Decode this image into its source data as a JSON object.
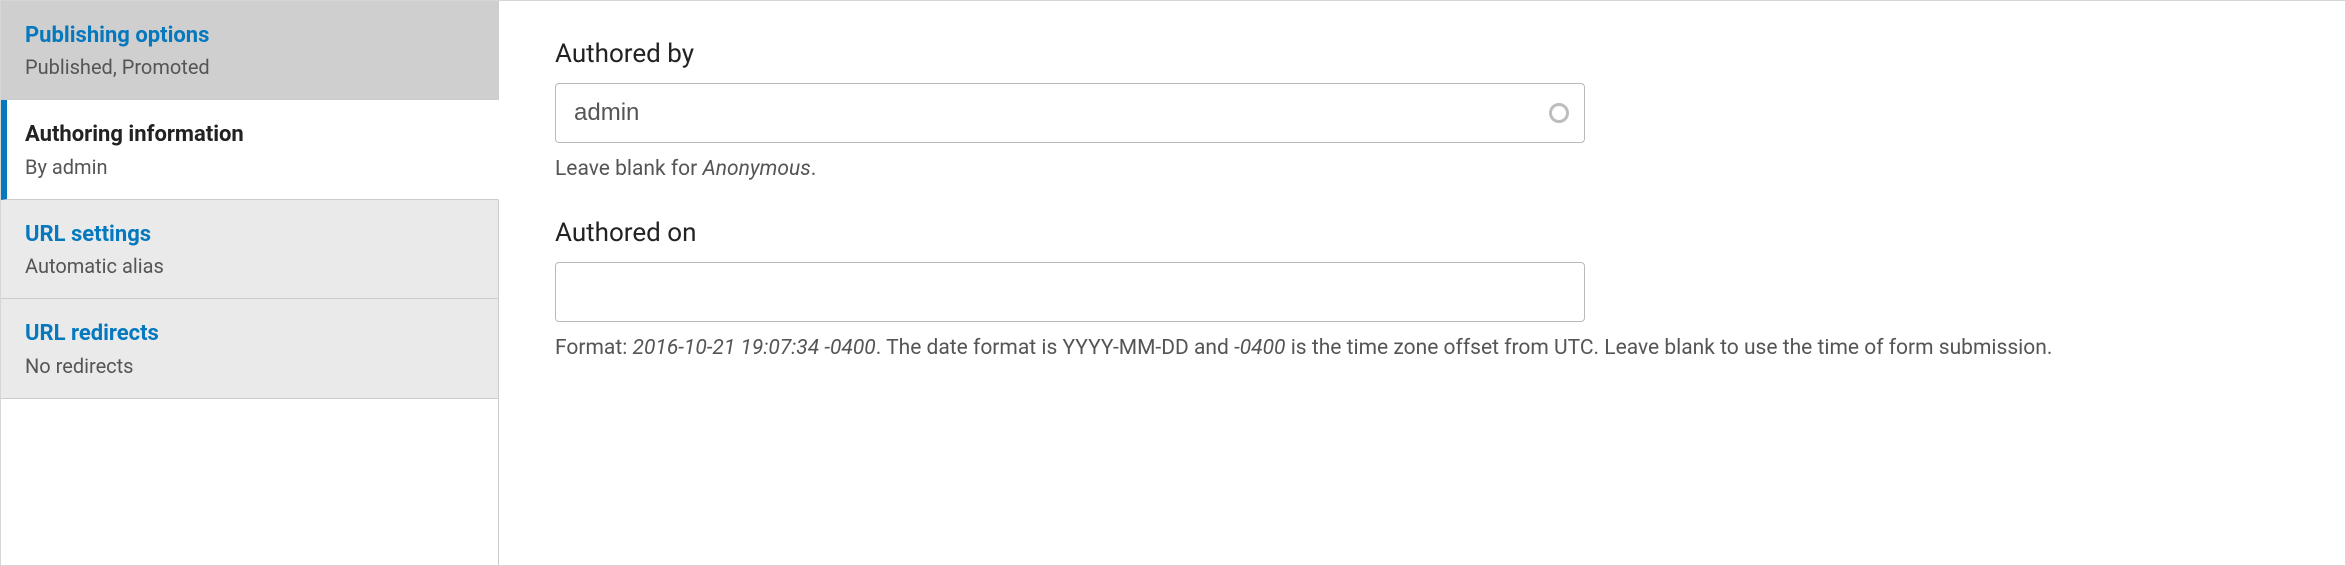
{
  "sidebar": {
    "tabs": [
      {
        "title": "Publishing options",
        "sub": "Published, Promoted"
      },
      {
        "title": "Authoring information",
        "sub": "By admin"
      },
      {
        "title": "URL settings",
        "sub": "Automatic alias"
      },
      {
        "title": "URL redirects",
        "sub": "No redirects"
      }
    ]
  },
  "panel": {
    "authored_by": {
      "label": "Authored by",
      "value": "admin",
      "help_prefix": "Leave blank for ",
      "help_em": "Anonymous",
      "help_suffix": "."
    },
    "authored_on": {
      "label": "Authored on",
      "value": "",
      "help_a": "Format: ",
      "help_b_em": "2016-10-21 19:07:34 -0400",
      "help_c": ". The date format is YYYY-MM-DD and ",
      "help_d_em": "-0400",
      "help_e": " is the time zone offset from UTC. Leave blank to use the time of form submission."
    }
  }
}
